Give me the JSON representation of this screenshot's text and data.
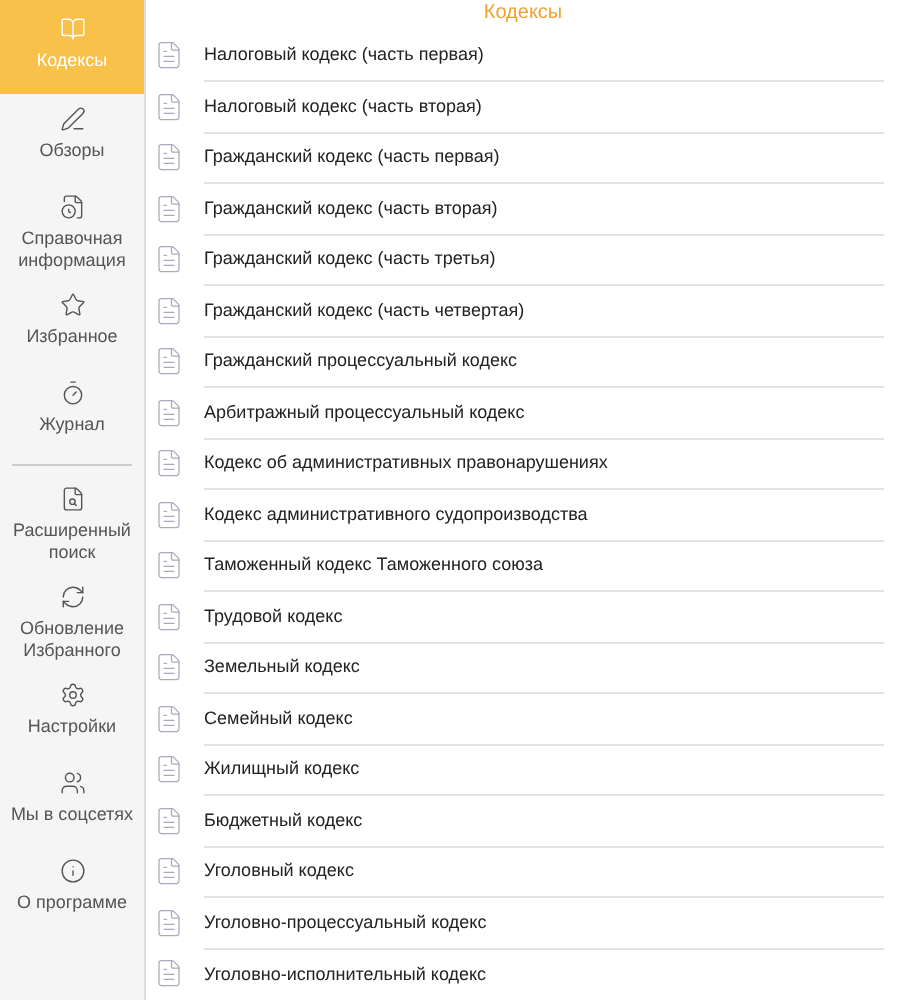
{
  "sidebar": {
    "items": [
      {
        "label": "Кодексы",
        "selected": true
      },
      {
        "label": "Обзоры",
        "selected": false
      },
      {
        "label": "Справочная информация",
        "selected": false
      },
      {
        "label": "Избранное",
        "selected": false
      },
      {
        "label": "Журнал",
        "selected": false
      },
      {
        "label": "Расширенный поиск",
        "selected": false,
        "divider_before": true
      },
      {
        "label": "Обновление Избранного",
        "selected": false
      },
      {
        "label": "Настройки",
        "selected": false
      },
      {
        "label": "Мы в соцсетях",
        "selected": false
      },
      {
        "label": "О программе",
        "selected": false
      }
    ]
  },
  "title": "Кодексы",
  "list": {
    "items": [
      "Налоговый кодекс (часть первая)",
      "Налоговый кодекс (часть вторая)",
      "Гражданский кодекс (часть первая)",
      "Гражданский кодекс (часть вторая)",
      "Гражданский кодекс (часть третья)",
      "Гражданский кодекс (часть четвертая)",
      "Гражданский процессуальный кодекс",
      "Арбитражный процессуальный кодекс",
      "Кодекс об административных правонарушениях",
      "Кодекс административного судопроизводства",
      "Таможенный кодекс Таможенного союза",
      "Трудовой кодекс",
      "Земельный кодекс",
      "Семейный кодекс",
      "Жилищный кодекс",
      "Бюджетный кодекс",
      "Уголовный кодекс",
      "Уголовно-процессуальный кодекс",
      "Уголовно-исполнительный кодекс"
    ]
  }
}
